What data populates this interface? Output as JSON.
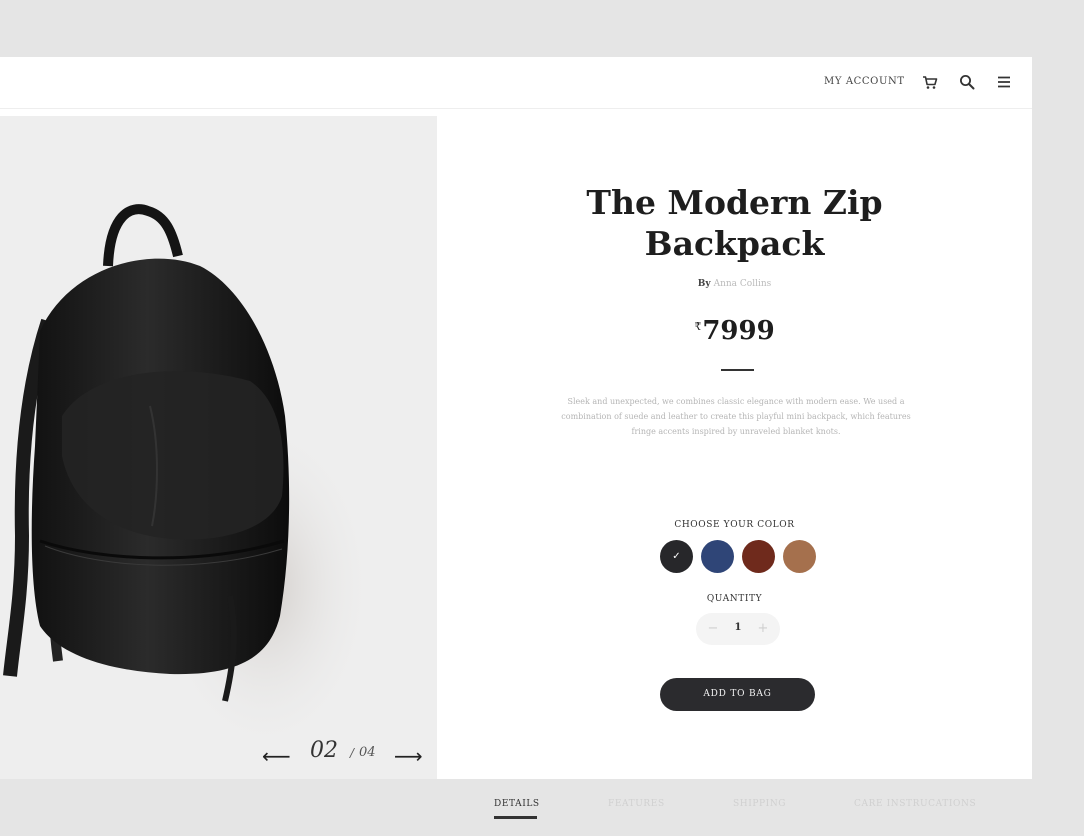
{
  "header": {
    "account_label": "MY ACCOUNT",
    "icons": [
      "cart-icon",
      "search-icon",
      "menu-icon"
    ]
  },
  "gallery": {
    "current": "02",
    "separator": "/",
    "total": "04",
    "prev_arrow": "⟵",
    "next_arrow": "⟶"
  },
  "product": {
    "title_line1": "The Modern Zip",
    "title_line2": "Backpack",
    "by_label": "By",
    "author": "Anna Collins",
    "currency_symbol": "₹",
    "price": "7999",
    "description": "Sleek and unexpected, we combines classic elegance with modern ease. We used a combination of suede and leather to create this playful mini backpack, which features fringe accents inspired by unraveled blanket knots."
  },
  "color": {
    "label": "CHOOSE YOUR COLOR",
    "options": [
      {
        "name": "black",
        "hex": "#27272a",
        "selected": true
      },
      {
        "name": "navy",
        "hex": "#2f4577",
        "selected": false
      },
      {
        "name": "brown",
        "hex": "#6f2a1c",
        "selected": false
      },
      {
        "name": "tan",
        "hex": "#a5704d",
        "selected": false
      }
    ],
    "check_glyph": "✓"
  },
  "quantity": {
    "label": "QUANTITY",
    "value": "1",
    "minus": "−",
    "plus": "+"
  },
  "cta": {
    "add_to_bag": "ADD TO BAG"
  },
  "tabs": [
    {
      "label": "DETAILS",
      "active": true
    },
    {
      "label": "FEATURES",
      "active": false
    },
    {
      "label": "SHIPPING",
      "active": false
    },
    {
      "label": "CARE INSTRUCATIONS",
      "active": false
    }
  ]
}
